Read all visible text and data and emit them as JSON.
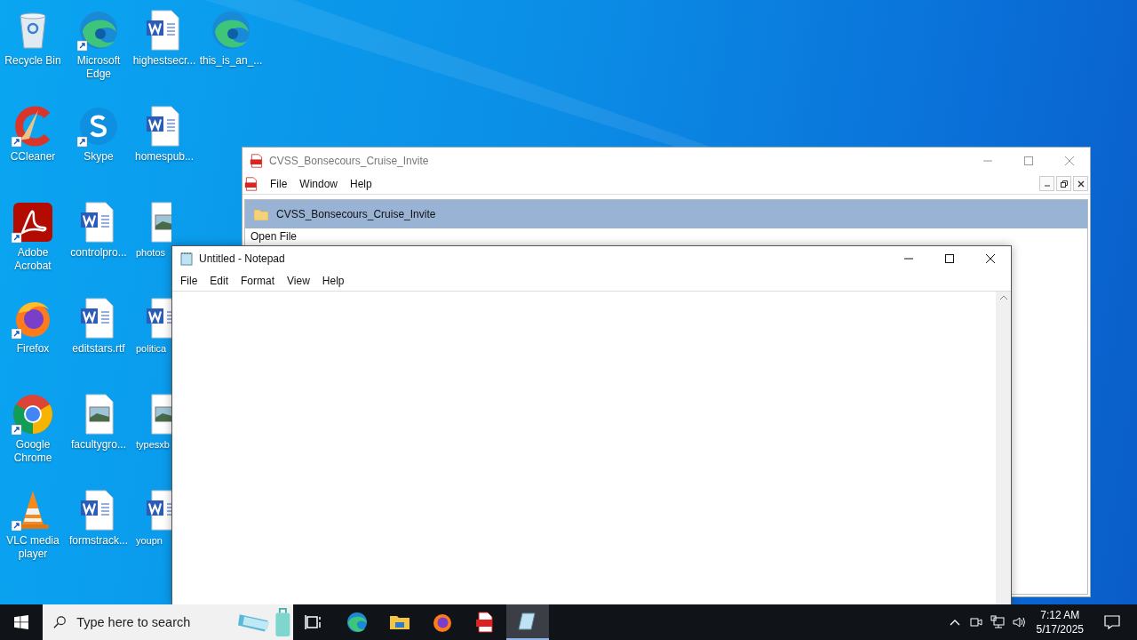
{
  "desktop_columns": [
    [
      {
        "label": "Recycle Bin",
        "kind": "recycle",
        "shortcut": false
      },
      {
        "label": "CCleaner",
        "kind": "ccleaner",
        "shortcut": true
      },
      {
        "label": "Adobe Acrobat",
        "kind": "acrobat",
        "shortcut": true
      },
      {
        "label": "Firefox",
        "kind": "firefox",
        "shortcut": true
      },
      {
        "label": "Google Chrome",
        "kind": "chrome",
        "shortcut": true
      },
      {
        "label": "VLC media player",
        "kind": "vlc",
        "shortcut": true
      }
    ],
    [
      {
        "label": "Microsoft Edge",
        "kind": "edge",
        "shortcut": true
      },
      {
        "label": "Skype",
        "kind": "skype",
        "shortcut": true
      },
      {
        "label": "controlpro...",
        "kind": "word",
        "shortcut": false
      },
      {
        "label": "editstars.rtf",
        "kind": "word",
        "shortcut": false
      },
      {
        "label": "facultygro...",
        "kind": "image",
        "shortcut": false
      },
      {
        "label": "formstrack...",
        "kind": "word",
        "shortcut": false
      }
    ],
    [
      {
        "label": "highestsecr...",
        "kind": "word",
        "shortcut": false,
        "cut": false
      },
      {
        "label": "homespub...",
        "kind": "word",
        "shortcut": false,
        "cut": false
      },
      {
        "label": "photos",
        "kind": "image",
        "shortcut": false,
        "cut": true
      },
      {
        "label": "politica",
        "kind": "word",
        "shortcut": false,
        "cut": true
      },
      {
        "label": "typesxb",
        "kind": "image",
        "shortcut": false,
        "cut": true
      },
      {
        "label": "youpn",
        "kind": "word",
        "shortcut": false,
        "cut": true
      }
    ],
    [
      {
        "label": "this_is_an_...",
        "kind": "edge",
        "shortcut": false
      }
    ]
  ],
  "pdf_window": {
    "title": "CVSS_Bonsecours_Cruise_Invite",
    "menu": [
      "File",
      "Window",
      "Help"
    ],
    "items": [
      {
        "label": "CVSS_Bonsecours_Cruise_Invite",
        "selected": true
      }
    ],
    "section_label": "Open File"
  },
  "notepad": {
    "title": "Untitled - Notepad",
    "menu": [
      "File",
      "Edit",
      "Format",
      "View",
      "Help"
    ]
  },
  "taskbar": {
    "search": {
      "placeholder": "Type here to search"
    },
    "apps": [
      {
        "kind": "taskview",
        "active": false
      },
      {
        "kind": "edge",
        "active": false
      },
      {
        "kind": "explorer",
        "active": false
      },
      {
        "kind": "firefox",
        "active": false
      },
      {
        "kind": "pdf",
        "active": false
      },
      {
        "kind": "notepad",
        "active": true
      }
    ],
    "time": "7:12 AM",
    "date": "5/17/2025"
  }
}
